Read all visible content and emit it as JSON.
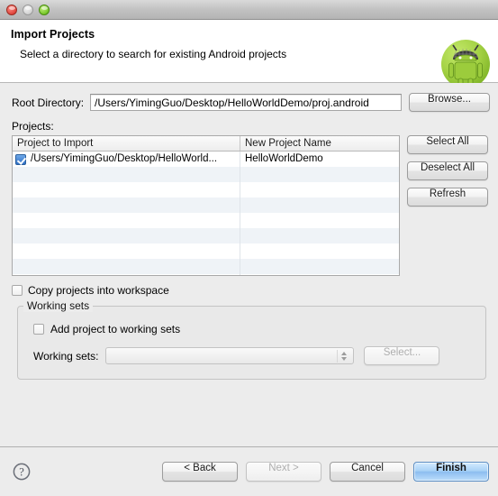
{
  "window": {
    "traffic_lights": [
      "close",
      "minimize",
      "zoom"
    ]
  },
  "header": {
    "title": "Import Projects",
    "subtitle": "Select a directory to search for existing Android projects",
    "badge_icon": "android-robot-icon"
  },
  "form": {
    "root_directory_label": "Root Directory:",
    "root_directory_value": "/Users/YimingGuo/Desktop/HelloWorldDemo/proj.android",
    "root_directory_placeholder": "",
    "browse_label": "Browse...",
    "projects_label": "Projects:"
  },
  "table": {
    "columns": [
      "Project to Import",
      "New Project Name"
    ],
    "rows": [
      {
        "checked": true,
        "project_to_import": "/Users/YimingGuo/Desktop/HelloWorld...",
        "new_project_name": "HelloWorldDemo"
      }
    ],
    "empty_row_count": 8
  },
  "side_buttons": [
    {
      "label": "Select All",
      "disabled": false
    },
    {
      "label": "Deselect All",
      "disabled": false
    },
    {
      "label": "Refresh",
      "disabled": false
    }
  ],
  "options": {
    "copy_projects_label": "Copy projects into workspace",
    "copy_projects_checked": false
  },
  "working_sets": {
    "group_title": "Working sets",
    "add_project_label": "Add project to working sets",
    "add_project_checked": false,
    "working_sets_label": "Working sets:",
    "working_sets_value": "",
    "select_label": "Select...",
    "select_disabled": true,
    "combo_disabled": true
  },
  "footer": {
    "help_icon": "question-mark-icon",
    "buttons": [
      {
        "name": "back",
        "label": "< Back",
        "disabled": false,
        "primary": false
      },
      {
        "name": "next",
        "label": "Next >",
        "disabled": true,
        "primary": false
      },
      {
        "name": "cancel",
        "label": "Cancel",
        "disabled": false,
        "primary": false
      },
      {
        "name": "finish",
        "label": "Finish",
        "disabled": false,
        "primary": true
      }
    ]
  },
  "colors": {
    "accent": "#8cbdf0",
    "checkbox_on": "#2f6fc4",
    "window_bg": "#ececec",
    "android_green": "#a4d244",
    "row_stripe": "#eff3f7"
  }
}
